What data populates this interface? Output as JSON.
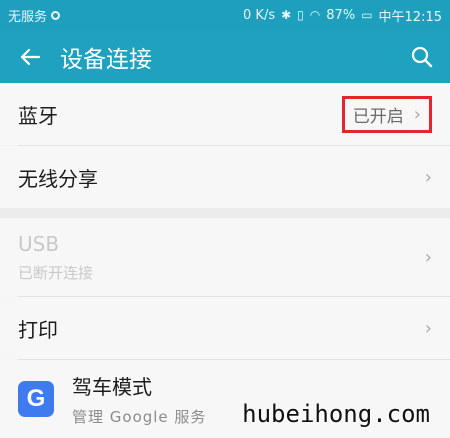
{
  "status_bar": {
    "carrier": "无服务",
    "speed": "0 K/s",
    "battery": "87%",
    "time": "中午12:15"
  },
  "app_bar": {
    "title": "设备连接"
  },
  "items": [
    {
      "title": "蓝牙",
      "status": "已开启"
    },
    {
      "title": "无线分享"
    },
    {
      "title": "USB",
      "subtitle": "已断开连接"
    },
    {
      "title": "打印"
    },
    {
      "title": "驾车模式",
      "subtitle": "管理 Google 服务",
      "icon_letter": "G"
    }
  ],
  "watermark": "hubeihong.com",
  "colors": {
    "accent": "#1fa2bf",
    "highlight_border": "#e2262a",
    "google_icon": "#3e7bef"
  },
  "icons": [
    "back-arrow-icon",
    "search-icon",
    "chevron-right-icon",
    "google-icon"
  ]
}
